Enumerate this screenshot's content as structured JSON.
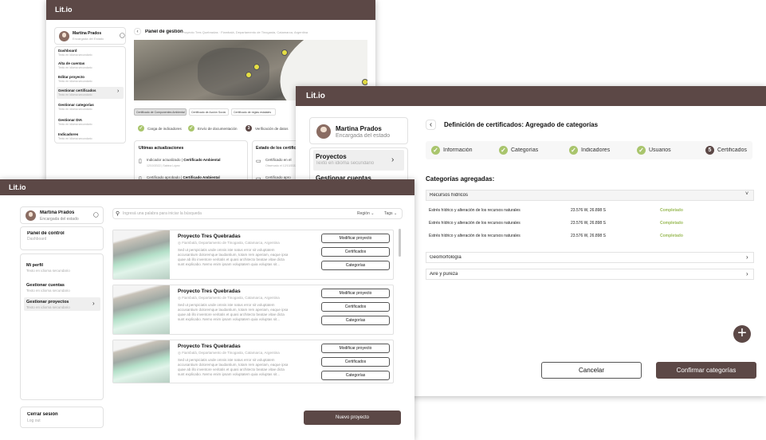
{
  "brand": "Lit.io",
  "colors": {
    "brand": "#5c4846",
    "success": "#a9c56d",
    "completed_text": "#9bbb58"
  },
  "user": {
    "name": "Martina Prados",
    "role": "Encargada del estado"
  },
  "back_window": {
    "user_role": "Encargada del Estado",
    "nav": [
      {
        "label": "Dashboard",
        "sub": "Texto en idioma secundario"
      },
      {
        "label": "Alta de cuentas",
        "sub": "Texto en idioma secundario"
      },
      {
        "label": "Editar proyecto",
        "sub": "Texto en idioma secundario"
      },
      {
        "label": "Gestionar certificados",
        "sub": "Texto en idioma secundario"
      },
      {
        "label": "Gestionar categorías",
        "sub": "Texto en idioma secundario"
      },
      {
        "label": "Gestionar DIA",
        "sub": "Texto en idioma secundario"
      },
      {
        "label": "Indicadores",
        "sub": "Texto en idioma secundario"
      }
    ],
    "title": "Panel de gestión",
    "crumbs": "Proyecto Tres Quebradas  ·  Fiambalá, Departamento de Tinogasta, Catamarca, Argentina",
    "cert_tabs": [
      "Certificado de Componentes Ambiental",
      "Certificado de Acción Social",
      "Certificado de reglas estatales"
    ],
    "steps": [
      "Carga de indicadores",
      "Envío de documentación",
      "Verificación de datos"
    ],
    "step3_num": "3",
    "updates_title": "Últimas actualizaciones",
    "updates": [
      {
        "pre": "Indicador actualizado | ",
        "bold": "Certificado Ambiental",
        "meta": "12/10/2022  |  Sabina López"
      },
      {
        "pre": "Certificado aprobado | ",
        "bold": "Certificado Ambiental",
        "meta": ""
      }
    ],
    "status_title": "Estado de los certificados",
    "status": [
      {
        "label": "Certificado en el",
        "meta": "Observado el 12/10/2022"
      },
      {
        "label": "Certificado apro",
        "meta": ""
      }
    ]
  },
  "right_window": {
    "nav_label": "Proyectos",
    "nav_sub": "Texto en idioma secundario",
    "nav_label2": "Gestionar cuentas",
    "title": "Definición de certificados: Agregado de categorías",
    "steps": [
      "Información",
      "Categorías",
      "Indicadores",
      "Usuarios",
      "Certificados"
    ],
    "step5_num": "5",
    "section_title": "Categorías agregadas:",
    "groups": [
      {
        "name": "Recursos hídricos",
        "rows": [
          {
            "name": "Estrés hídrico y alteración de los recursos naturales",
            "coords": "23.576 W, 26.898 S",
            "status": "Completado"
          },
          {
            "name": "Estrés hídrico y alteración de los recursos naturales",
            "coords": "23.576 W, 26.898 S",
            "status": "Completado"
          },
          {
            "name": "Estrés hídrico y alteración de los recursos naturales",
            "coords": "23.576 W, 26.898 S",
            "status": "Completado"
          }
        ]
      },
      {
        "name": "Geomorfología"
      },
      {
        "name": "Aire y pureza"
      }
    ],
    "cancel": "Cancelar",
    "confirm": "Confirmar categorías",
    "add_icon": "+"
  },
  "front_window": {
    "nav_title": "Panel de control",
    "nav_title_sub": "Dashboard",
    "nav": [
      {
        "label": "Mi perfil",
        "sub": "Texto en idioma secundario"
      },
      {
        "label": "Gestionar cuentas",
        "sub": "Texto en idioma secundario"
      },
      {
        "label": "Gestionar proyectos",
        "sub": "Texto en idioma secundario"
      }
    ],
    "logout": "Cerrar sesión",
    "logout_sub": "Log out",
    "search_placeholder": "Ingresá una palabra para iniciar la búsqueda",
    "filter_region": "Región",
    "filter_tags": "Tags",
    "projects": [
      {
        "title": "Proyecto Tres Quebradas",
        "location": "Fiambalá, Departamento de Tinogasta, Catamarca, Argentina",
        "desc": [
          "Sed ut perspiciatis unde omnis iste natus error sit voluptatem",
          "accusantium doloremque laudantium, totam rem aperiam, eaque ipsa",
          "quae ab illo inventore veritatis et quasi architecto beatae vitae dicta",
          "sunt explicabo. Nemo enim ipsam voluptatem quia voluptas sit..."
        ],
        "buttons": [
          "Modificar proyecto",
          "Certificados",
          "Categorías"
        ]
      },
      {
        "title": "Proyecto Tres Quebradas",
        "location": "Fiambalá, Departamento de Tinogasta, Catamarca, Argentina",
        "desc": [
          "Sed ut perspiciatis unde omnis iste natus error sit voluptatem",
          "accusantium doloremque laudantium, totam rem aperiam, eaque ipsa",
          "quae ab illo inventore veritatis et quasi architecto beatae vitae dicta",
          "sunt explicabo. Nemo enim ipsam voluptatem quia voluptas sit..."
        ],
        "buttons": [
          "Modificar proyecto",
          "Certificados",
          "Categorías"
        ]
      },
      {
        "title": "Proyecto Tres Quebradas",
        "location": "Fiambalá, Departamento de Tinogasta, Catamarca, Argentina",
        "desc": [
          "Sed ut perspiciatis unde omnis iste natus error sit voluptatem",
          "accusantium doloremque laudantium, totam rem aperiam, eaque ipsa",
          "quae ab illo inventore veritatis et quasi architecto beatae vitae dicta",
          "sunt explicabo. Nemo enim ipsam voluptatem quia voluptas sit..."
        ],
        "buttons": [
          "Modificar proyecto",
          "Certificados",
          "Categorías"
        ]
      }
    ],
    "new_project": "Nuevo proyecto"
  }
}
